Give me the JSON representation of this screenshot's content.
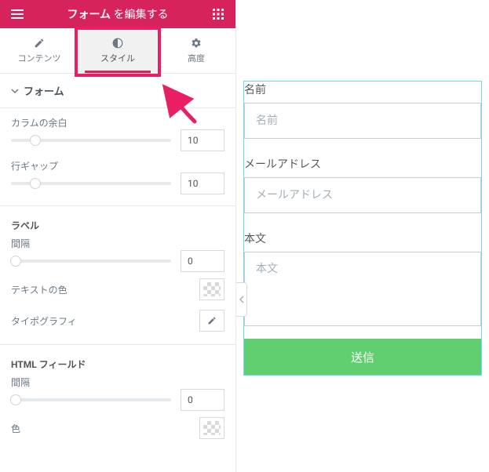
{
  "header": {
    "title_strong": "フォーム",
    "title_rest": "を編集する"
  },
  "tabs": {
    "content": {
      "label": "コンテンツ"
    },
    "style": {
      "label": "スタイル"
    },
    "advanced": {
      "label": "高度"
    }
  },
  "sections": {
    "form": {
      "title": "フォーム",
      "column_gap_label": "カラムの余白",
      "column_gap_value": "10",
      "row_gap_label": "行ギャップ",
      "row_gap_value": "10"
    },
    "label": {
      "title": "ラベル",
      "spacing_label": "間隔",
      "spacing_value": "0",
      "text_color_label": "テキストの色",
      "typography_label": "タイポグラフィ"
    },
    "html_field": {
      "title": "HTML フィールド",
      "spacing_label": "間隔",
      "spacing_value": "0",
      "color_label": "色"
    }
  },
  "preview_form": {
    "name": {
      "label": "名前",
      "placeholder": "名前"
    },
    "email": {
      "label": "メールアドレス",
      "placeholder": "メールアドレス"
    },
    "message": {
      "label": "本文",
      "placeholder": "本文"
    },
    "submit": {
      "label": "送信"
    }
  }
}
